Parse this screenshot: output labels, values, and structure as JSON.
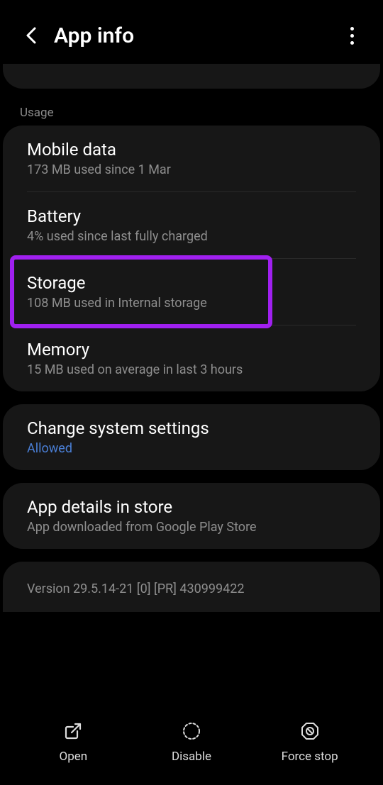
{
  "header": {
    "title": "App info"
  },
  "section_usage_label": "Usage",
  "usage": {
    "mobile_data": {
      "title": "Mobile data",
      "subtitle": "173 MB used since 1 Mar"
    },
    "battery": {
      "title": "Battery",
      "subtitle": "4% used since last fully charged"
    },
    "storage": {
      "title": "Storage",
      "subtitle": "108 MB used in Internal storage"
    },
    "memory": {
      "title": "Memory",
      "subtitle": "15 MB used on average in last 3 hours"
    }
  },
  "change_settings": {
    "title": "Change system settings",
    "subtitle": "Allowed"
  },
  "app_details": {
    "title": "App details in store",
    "subtitle": "App downloaded from Google Play Store"
  },
  "version": "Version 29.5.14-21 [0] [PR] 430999422",
  "bottom": {
    "open": "Open",
    "disable": "Disable",
    "force_stop": "Force stop"
  }
}
